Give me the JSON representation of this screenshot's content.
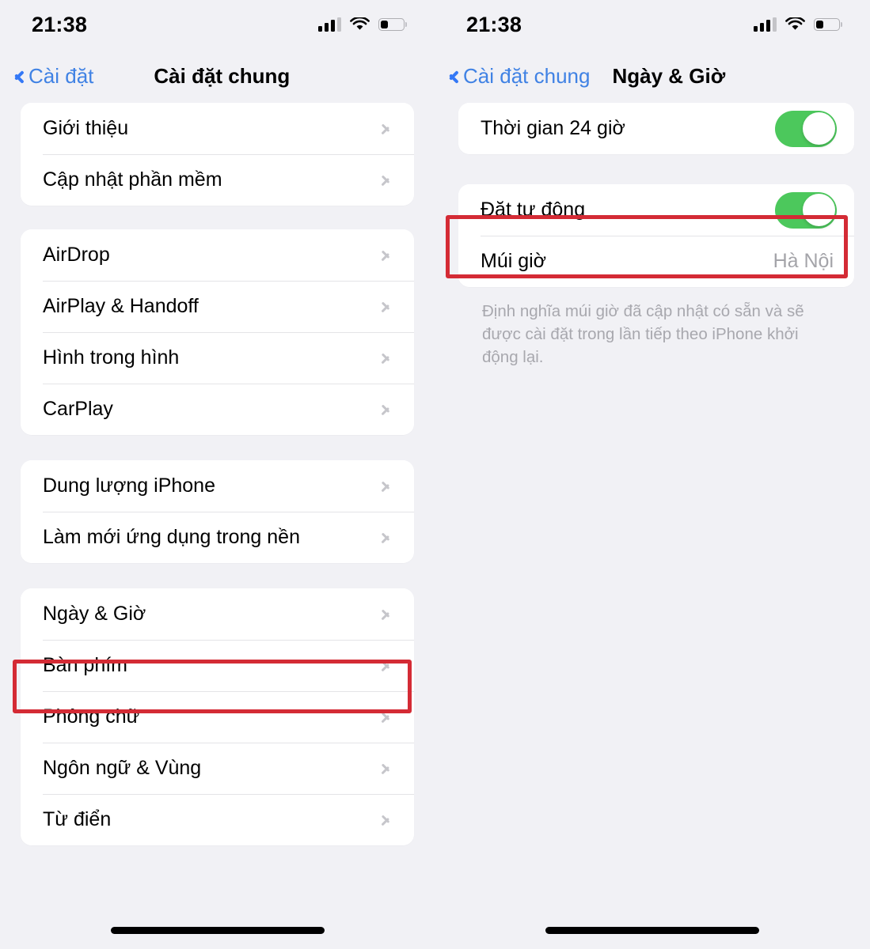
{
  "theme": {
    "background": "#F1F1F5",
    "card": "#FFFFFF",
    "accent_blue": "#4082E4",
    "toggle_green": "#4CC85C",
    "highlight_red": "#D42B35",
    "value_gray": "#A4A4A9"
  },
  "left_screen": {
    "status_bar": {
      "time": "21:38",
      "icons": [
        "cellular-signal-icon",
        "wifi-icon",
        "battery-icon"
      ],
      "battery_percent": 35
    },
    "nav": {
      "back_label": "Cài đặt",
      "back_icon": "chevron-left-icon",
      "title": "Cài đặt chung"
    },
    "groups": [
      {
        "rows": [
          {
            "label": "Giới thiệu",
            "accessory": "chevron-right-icon"
          },
          {
            "label": "Cập nhật phần mềm",
            "accessory": "chevron-right-icon"
          }
        ]
      },
      {
        "rows": [
          {
            "label": "AirDrop",
            "accessory": "chevron-right-icon"
          },
          {
            "label": "AirPlay & Handoff",
            "accessory": "chevron-right-icon"
          },
          {
            "label": "Hình trong hình",
            "accessory": "chevron-right-icon"
          },
          {
            "label": "CarPlay",
            "accessory": "chevron-right-icon"
          }
        ]
      },
      {
        "rows": [
          {
            "label": "Dung lượng iPhone",
            "accessory": "chevron-right-icon"
          },
          {
            "label": "Làm mới ứng dụng trong nền",
            "accessory": "chevron-right-icon"
          }
        ]
      },
      {
        "rows": [
          {
            "label": "Ngày & Giờ",
            "accessory": "chevron-right-icon",
            "highlighted": true
          },
          {
            "label": "Bàn phím",
            "accessory": "chevron-right-icon"
          },
          {
            "label": "Phông chữ",
            "accessory": "chevron-right-icon"
          },
          {
            "label": "Ngôn ngữ & Vùng",
            "accessory": "chevron-right-icon"
          },
          {
            "label": "Từ điển",
            "accessory": "chevron-right-icon"
          }
        ]
      }
    ]
  },
  "right_screen": {
    "status_bar": {
      "time": "21:38",
      "icons": [
        "cellular-signal-icon",
        "wifi-icon",
        "battery-icon"
      ],
      "battery_percent": 35
    },
    "nav": {
      "back_label": "Cài đặt chung",
      "back_icon": "chevron-left-icon",
      "title": "Ngày & Giờ"
    },
    "groups": [
      {
        "rows": [
          {
            "label": "Thời gian 24 giờ",
            "accessory": "toggle",
            "toggle_on": true
          }
        ]
      },
      {
        "rows": [
          {
            "label": "Đặt tự động",
            "accessory": "toggle",
            "toggle_on": true,
            "highlighted": true
          },
          {
            "label": "Múi giờ",
            "accessory": "value",
            "value": "Hà Nội"
          }
        ],
        "footnote": "Định nghĩa múi giờ đã cập nhật có sẵn và sẽ được cài đặt trong lần tiếp theo iPhone khởi động lại."
      }
    ]
  }
}
